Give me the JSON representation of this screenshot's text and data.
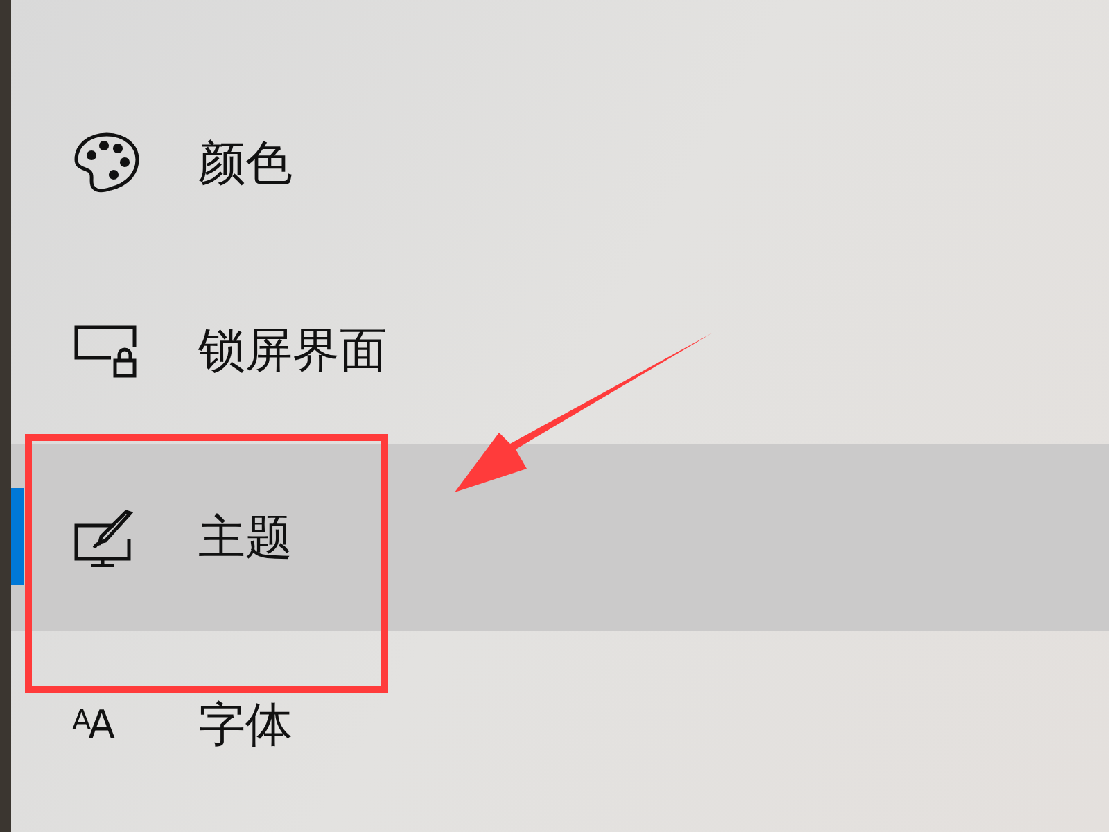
{
  "nav_items": [
    {
      "kind": "colors",
      "label": "颜色",
      "selected": false
    },
    {
      "kind": "lockscreen",
      "label": "锁屏界面",
      "selected": false
    },
    {
      "kind": "themes",
      "label": "主题",
      "selected": true
    },
    {
      "kind": "fonts",
      "label": "字体",
      "selected": false,
      "icon_glyph": "AA"
    }
  ]
}
